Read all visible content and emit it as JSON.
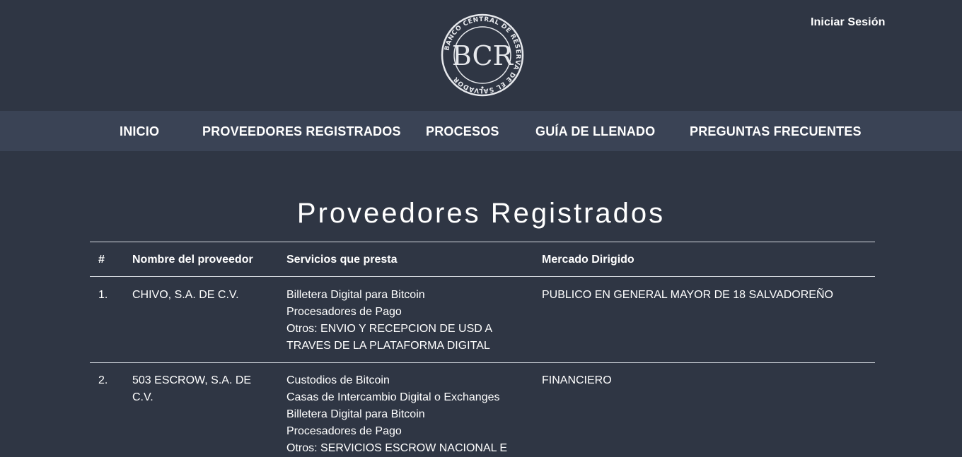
{
  "header": {
    "logo_alt": "BCR",
    "login_label": "Iniciar Sesión"
  },
  "nav": {
    "items": [
      {
        "label": "INICIO"
      },
      {
        "label": "PROVEEDORES REGISTRADOS"
      },
      {
        "label": "PROCESOS"
      },
      {
        "label": "GUÍA DE LLENADO"
      },
      {
        "label": "PREGUNTAS FRECUENTES"
      }
    ]
  },
  "main": {
    "title": "Proveedores Registrados",
    "table": {
      "headers": [
        "#",
        "Nombre del proveedor",
        "Servicios que presta",
        "Mercado Dirigido"
      ],
      "rows": [
        {
          "num": "1.",
          "name": "CHIVO, S.A. DE C.V.",
          "services": [
            "Billetera Digital para Bitcoin",
            "Procesadores de Pago",
            "Otros: ENVIO Y RECEPCION DE USD A",
            "TRAVES DE LA PLATAFORMA DIGITAL"
          ],
          "market": "PUBLICO EN GENERAL MAYOR DE 18 SALVADOREÑO"
        },
        {
          "num": "2.",
          "name": "503 ESCROW, S.A. DE C.V.",
          "services": [
            "Custodios de Bitcoin",
            "Casas de Intercambio Digital o Exchanges",
            "Billetera Digital para Bitcoin",
            "Procesadores de Pago",
            "Otros: SERVICIOS ESCROW NACIONAL E"
          ],
          "market": "FINANCIERO"
        }
      ]
    }
  },
  "colors": {
    "background": "#2f3644",
    "navbar": "#3a4355",
    "text": "#ffffff"
  }
}
